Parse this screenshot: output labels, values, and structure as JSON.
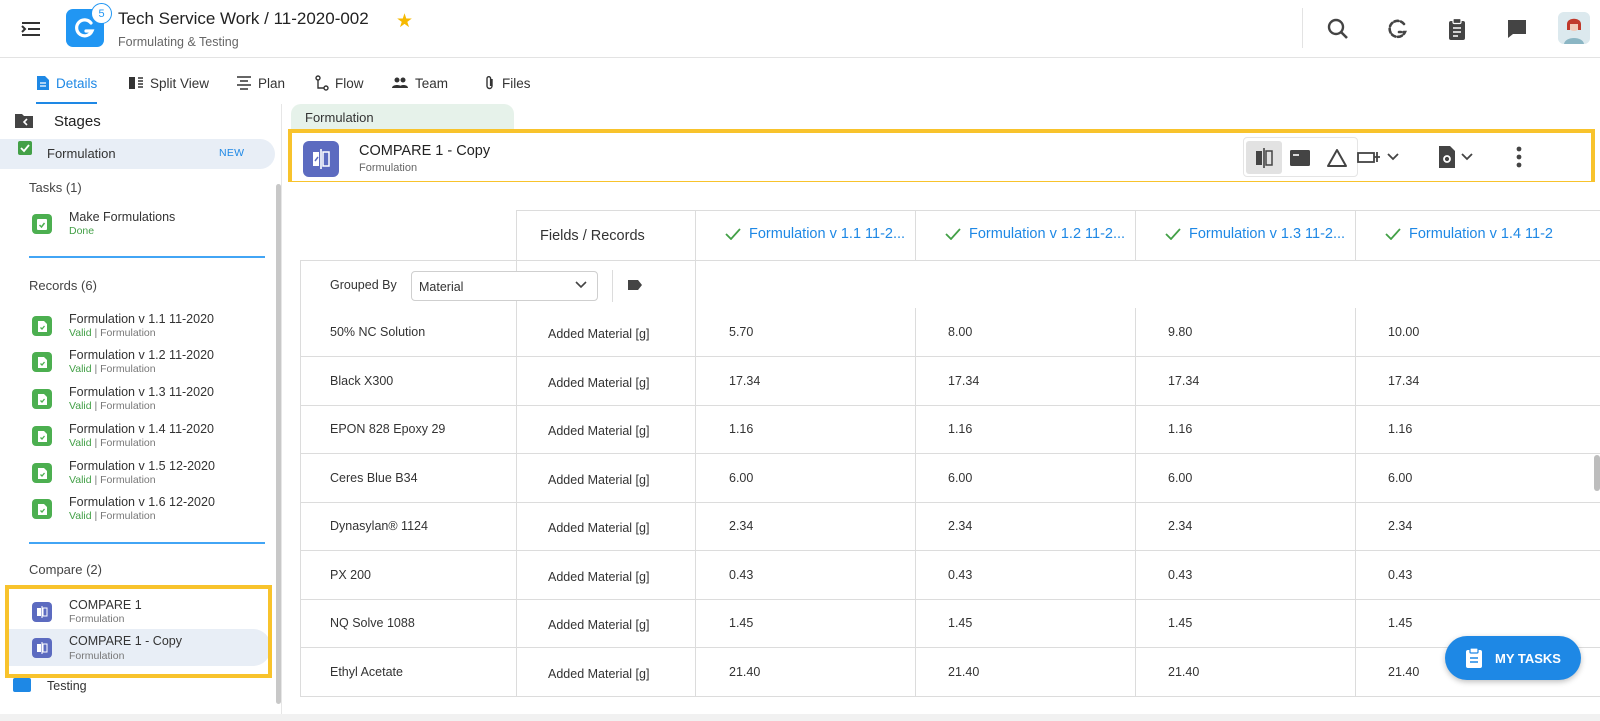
{
  "app": {
    "title": "Tech Service Work / 11-2020-002",
    "subtitle": "Formulating & Testing",
    "badge_count": "5"
  },
  "tabs": [
    {
      "label": "Details",
      "icon": "document-icon",
      "active": true
    },
    {
      "label": "Split View",
      "icon": "split-view-icon"
    },
    {
      "label": "Plan",
      "icon": "plan-icon"
    },
    {
      "label": "Flow",
      "icon": "flow-icon"
    },
    {
      "label": "Team",
      "icon": "team-icon"
    },
    {
      "label": "Files",
      "icon": "paperclip-icon"
    }
  ],
  "sidebar": {
    "stages_label": "Stages",
    "stage": {
      "label": "Formulation",
      "badge": "NEW"
    },
    "tasks": {
      "header": "Tasks (1)",
      "items": [
        {
          "title": "Make Formulations",
          "status": "Done"
        }
      ]
    },
    "records": {
      "header": "Records (6)",
      "items": [
        {
          "title": "Formulation v 1.1 11-2020",
          "status": "Valid",
          "type": "| Formulation"
        },
        {
          "title": "Formulation v 1.2 11-2020",
          "status": "Valid",
          "type": "| Formulation"
        },
        {
          "title": "Formulation v 1.3 11-2020",
          "status": "Valid",
          "type": "| Formulation"
        },
        {
          "title": "Formulation v 1.4 11-2020",
          "status": "Valid",
          "type": "| Formulation"
        },
        {
          "title": "Formulation v 1.5 12-2020",
          "status": "Valid",
          "type": "| Formulation"
        },
        {
          "title": "Formulation v 1.6 12-2020",
          "status": "Valid",
          "type": "| Formulation"
        }
      ]
    },
    "compare": {
      "header": "Compare (2)",
      "items": [
        {
          "title": "COMPARE 1",
          "subtitle": "Formulation"
        },
        {
          "title": "COMPARE 1 - Copy",
          "subtitle": "Formulation"
        }
      ]
    },
    "next_stage": "Testing"
  },
  "main": {
    "stage_tab": "Formulation",
    "record": {
      "title": "COMPARE 1 - Copy",
      "subtitle": "Formulation"
    },
    "table": {
      "fields_header": "Fields / Records",
      "grouped_by_label": "Grouped By",
      "grouped_by_value": "Material",
      "columns": [
        "Formulation v 1.1 11-2...",
        "Formulation v 1.2 11-2...",
        "Formulation v 1.3 11-2...",
        "Formulation v 1.4 11-2"
      ],
      "rows": [
        {
          "material": "50% NC Solution",
          "field": "Added Material [g]",
          "values": [
            "5.70",
            "8.00",
            "9.80",
            "10.00"
          ]
        },
        {
          "material": "Black X300",
          "field": "Added Material [g]",
          "values": [
            "17.34",
            "17.34",
            "17.34",
            "17.34"
          ]
        },
        {
          "material": "EPON 828 Epoxy 29",
          "field": "Added Material [g]",
          "values": [
            "1.16",
            "1.16",
            "1.16",
            "1.16"
          ]
        },
        {
          "material": "Ceres Blue B34",
          "field": "Added Material [g]",
          "values": [
            "6.00",
            "6.00",
            "6.00",
            "6.00"
          ]
        },
        {
          "material": "Dynasylan® 1124",
          "field": "Added Material [g]",
          "values": [
            "2.34",
            "2.34",
            "2.34",
            "2.34"
          ]
        },
        {
          "material": "PX 200",
          "field": "Added Material [g]",
          "values": [
            "0.43",
            "0.43",
            "0.43",
            "0.43"
          ]
        },
        {
          "material": "NQ Solve 1088",
          "field": "Added Material [g]",
          "values": [
            "1.45",
            "1.45",
            "1.45",
            "1.45"
          ]
        },
        {
          "material": "Ethyl Acetate",
          "field": "Added Material [g]",
          "values": [
            "21.40",
            "21.40",
            "21.40",
            "21.40"
          ]
        }
      ]
    }
  },
  "fab": {
    "label": "MY TASKS"
  },
  "colors": {
    "accent": "#1e88e5",
    "success": "#43a047",
    "compare_icon": "#5c6bc0",
    "highlight": "#f8c32c"
  }
}
